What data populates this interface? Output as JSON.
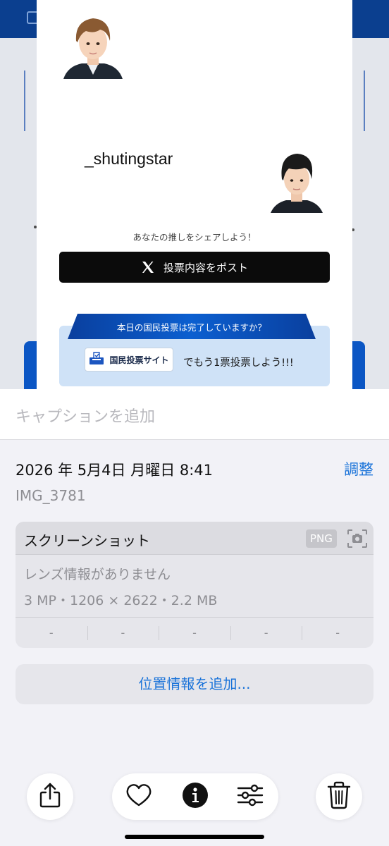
{
  "photo": {
    "username": "_shutingstar",
    "share_prompt": "あなたの推しをシェアしよう！",
    "post_button_label": "投票内容をポスト",
    "vote_banner": "本日の国民投票は完了していますか？",
    "site_button_label": "国民投票サイト",
    "vote_tail": "でもう1票投票しよう!!!"
  },
  "sheet": {
    "caption_placeholder": "キャプションを追加",
    "datetime": "2026 年 5月4日 月曜日 8:41",
    "adjust_label": "調整",
    "filename": "IMG_3781",
    "info": {
      "title": "スクリーンショット",
      "format_badge": "PNG",
      "lens": "レンズ情報がありません",
      "meta": "3 MP・1206 × 2622・2.2 MB",
      "dashes": [
        "-",
        "-",
        "-",
        "-",
        "-"
      ]
    },
    "location_label": "位置情報を追加..."
  },
  "toolbar": {
    "icons": [
      "share-icon",
      "heart-icon",
      "info-icon",
      "adjustments-icon",
      "trash-icon"
    ]
  },
  "colors": {
    "accent": "#1a73d9",
    "banner_blue": "#0b56c4",
    "post_button": "#0b0b0b"
  }
}
